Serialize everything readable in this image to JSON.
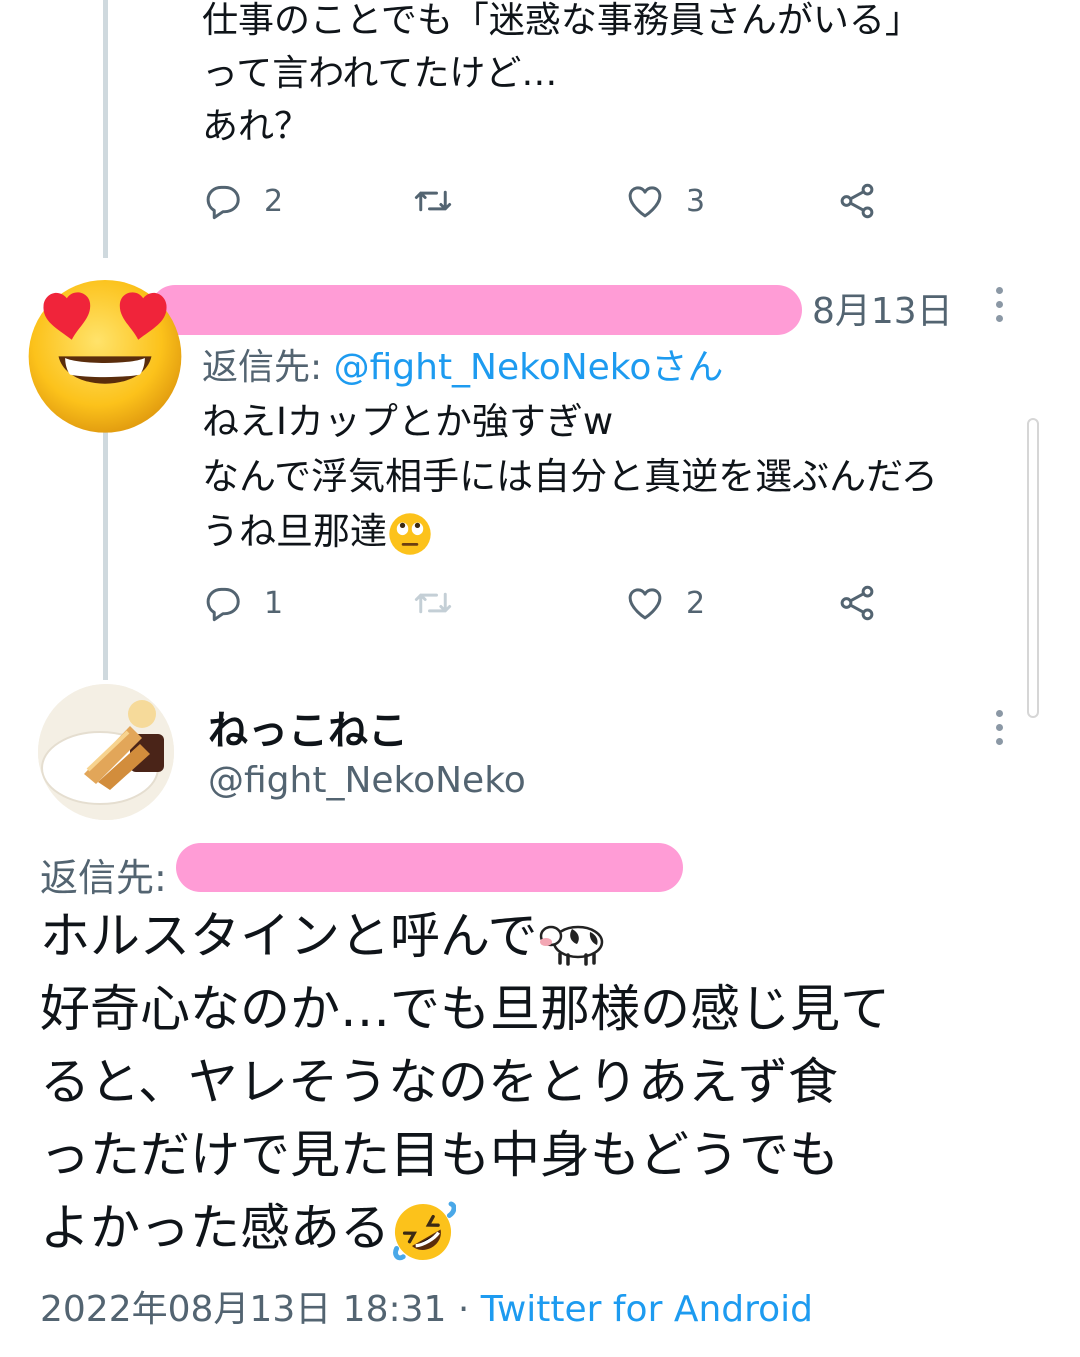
{
  "tweet_prev": {
    "text_lines": [
      "仕事のことでも「迷惑な事務員さんがいる」",
      "って言われてたけど…",
      "あれ？"
    ],
    "reply_count": "2",
    "retweet_count": "",
    "like_count": "3"
  },
  "tweet_reply": {
    "date": "8月13日",
    "reply_to_label": "返信先:",
    "reply_to_handle": "@fight_NekoNekoさん",
    "text_lines": [
      "ねえIカップとか強すぎw",
      "なんで浮気相手には自分と真逆を選ぶんだろ",
      "うね旦那達"
    ],
    "reply_count": "1",
    "retweet_count": "",
    "like_count": "2"
  },
  "main_tweet": {
    "display_name": "ねっこねこ",
    "handle": "@fight_NekoNeko",
    "reply_to_label": "返信先:",
    "text_lines": [
      "ホルスタインと呼んで",
      "好奇心なのか…でも旦那様の感じ見て",
      "ると、ヤレそうなのをとりあえず食",
      "っただけで見た目も中身もどうでも",
      "よかった感ある"
    ],
    "timestamp": "2022年08月13日 18:31",
    "separator": " · ",
    "source": "Twitter for Android"
  },
  "icons": [
    "reply-icon",
    "retweet-icon",
    "like-icon",
    "share-icon",
    "more-icon",
    "heart-eyes-emoji",
    "cow-emoji",
    "rolling-eyes-emoji",
    "rofl-emoji"
  ],
  "colors": {
    "accent": "#1d9bf0",
    "muted": "#536471",
    "redaction": "#ff9cd6",
    "thread_line": "#cfd9de"
  }
}
